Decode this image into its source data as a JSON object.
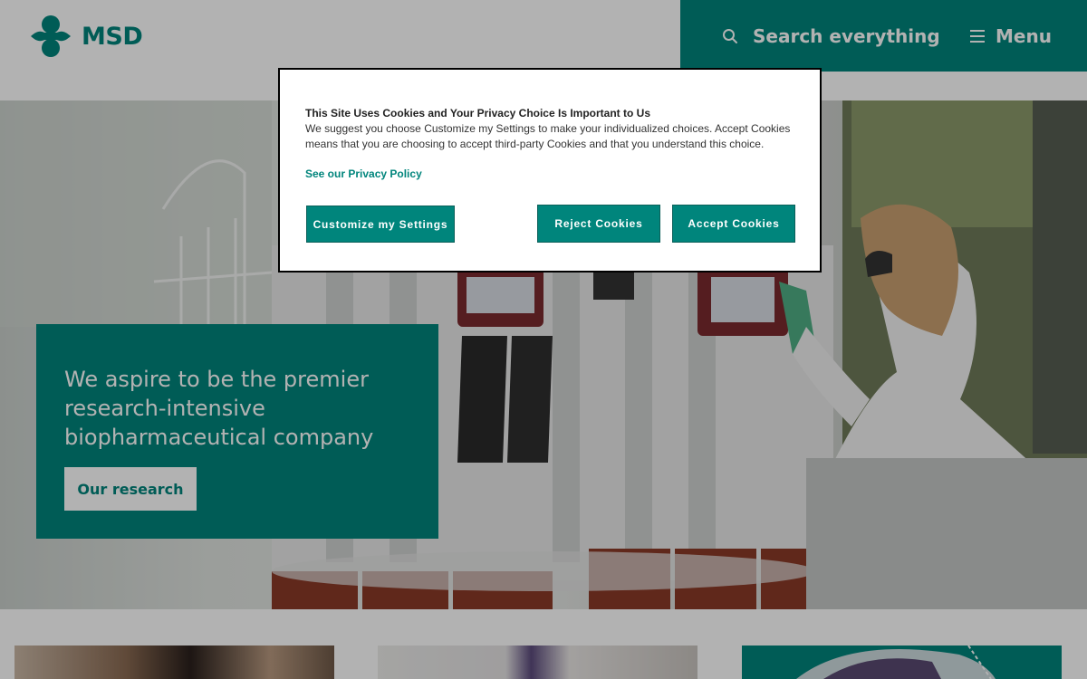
{
  "colors": {
    "brand": "#00857c",
    "overlay": "rgba(0,0,0,0.30)",
    "white": "#ffffff"
  },
  "header": {
    "logo_text": "MSD",
    "logo_icon": "msd-logo-icon",
    "search": {
      "label": "Search everything",
      "icon": "search-icon"
    },
    "menu": {
      "label": "Menu",
      "icon": "hamburger-icon"
    }
  },
  "hero": {
    "title": "We aspire to be the premier research-intensive biopharmaceutical company",
    "cta_label": "Our research"
  },
  "cookie_dialog": {
    "title": "This Site Uses Cookies and Your Privacy Choice Is Important to Us",
    "description": "We suggest you choose Customize my Settings to make your individualized choices. Accept Cookies means that you are choosing to accept third-party Cookies and that you understand this choice.",
    "privacy_link": "See our Privacy Policy",
    "buttons": {
      "customize": "Customize my Settings",
      "reject": "Reject Cookies",
      "accept": "Accept Cookies"
    }
  }
}
